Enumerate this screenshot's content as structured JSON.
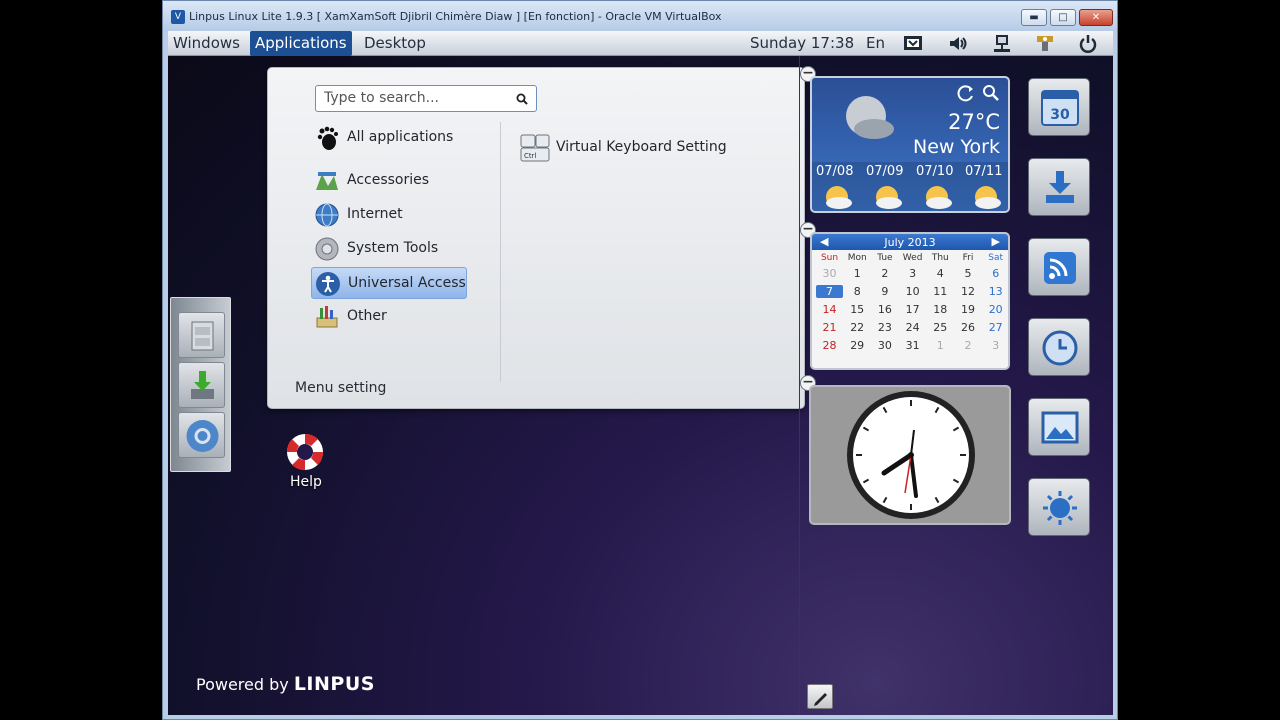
{
  "host_window": {
    "title": "Linpus Linux Lite 1.9.3 [ XamXamSoft Djibril Chimère Diaw ] [En fonction] - Oracle VM VirtualBox",
    "minimize_label": "▬",
    "maximize_label": "□",
    "close_label": "✕"
  },
  "topbar": {
    "menus": [
      "Windows",
      "Applications",
      "Desktop"
    ],
    "active_menu": "Applications",
    "clock": "Sunday 17:38",
    "lang": "En"
  },
  "menu": {
    "search_placeholder": "Type to search...",
    "categories": [
      {
        "label": "All applications",
        "icon": "gnome-foot-icon"
      },
      {
        "label": "Accessories",
        "icon": "accessories-icon"
      },
      {
        "label": "Internet",
        "icon": "globe-icon"
      },
      {
        "label": "System Tools",
        "icon": "system-tools-icon"
      },
      {
        "label": "Universal Access",
        "icon": "accessibility-icon",
        "selected": true
      },
      {
        "label": "Other",
        "icon": "other-icon"
      }
    ],
    "apps": [
      {
        "label": "Virtual Keyboard Setting",
        "icon": "keyboard-icon",
        "icon_text": "Ctrl"
      }
    ],
    "setting_label": "Menu setting"
  },
  "weather": {
    "temperature": "27°C",
    "city": "New York",
    "days": [
      "07/08",
      "07/09",
      "07/10",
      "07/11"
    ]
  },
  "calendar": {
    "month": "July 2013",
    "weekdays": [
      "Sun",
      "Mon",
      "Tue",
      "Wed",
      "Thu",
      "Fri",
      "Sat"
    ],
    "weeks": [
      [
        "30",
        "1",
        "2",
        "3",
        "4",
        "5",
        "6"
      ],
      [
        "7",
        "8",
        "9",
        "10",
        "11",
        "12",
        "13"
      ],
      [
        "14",
        "15",
        "16",
        "17",
        "18",
        "19",
        "20"
      ],
      [
        "21",
        "22",
        "23",
        "24",
        "25",
        "26",
        "27"
      ],
      [
        "28",
        "29",
        "30",
        "31",
        "1",
        "2",
        "3"
      ]
    ],
    "today": "7",
    "dock_date": "30"
  },
  "clock_widget": {
    "time": "17:38"
  },
  "desktop": {
    "help_label": "Help",
    "powered_prefix": "Powered by",
    "powered_brand": "LINPUS"
  },
  "colors": {
    "accent": "#1c4f93",
    "selection": "#9bbff0",
    "weekend_red": "#c62222",
    "weekend_blue": "#2b6fd1"
  }
}
